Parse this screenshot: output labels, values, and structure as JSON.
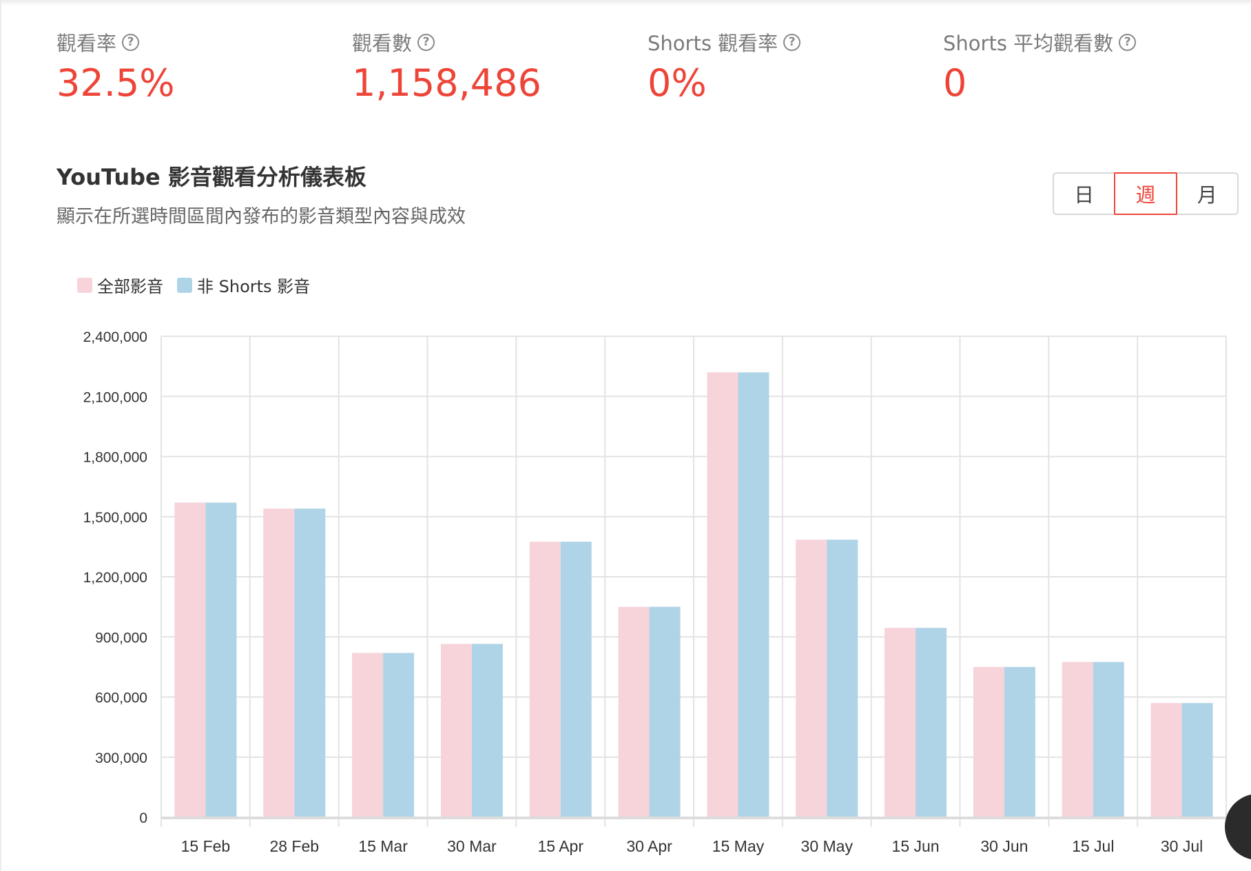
{
  "stats": [
    {
      "label": "觀看率",
      "value": "32.5%"
    },
    {
      "label": "觀看數",
      "value": "1,158,486"
    },
    {
      "label": "Shorts 觀看率",
      "value": "0%"
    },
    {
      "label": "Shorts 平均觀看數",
      "value": "0"
    }
  ],
  "help_glyph": "?",
  "section": {
    "title": "YouTube 影音觀看分析儀表板",
    "subtitle": "顯示在所選時間區間內發布的影音類型內容與成效"
  },
  "period_toggle": {
    "options": [
      "日",
      "週",
      "月"
    ],
    "selected": "週"
  },
  "colors": {
    "accent": "#ee4438",
    "series_all": "#f7d3da",
    "series_non_shorts": "#b0d4e7"
  },
  "chart_data": {
    "type": "bar",
    "categories": [
      "15 Feb",
      "28 Feb",
      "15 Mar",
      "30 Mar",
      "15 Apr",
      "30 Apr",
      "15 May",
      "30 May",
      "15 Jun",
      "30 Jun",
      "15 Jul",
      "30 Jul"
    ],
    "series": [
      {
        "name": "全部影音",
        "color": "#f7d3da",
        "values": [
          1570000,
          1540000,
          820000,
          865000,
          1375000,
          1050000,
          2220000,
          1385000,
          945000,
          750000,
          775000,
          570000
        ]
      },
      {
        "name": "非 Shorts 影音",
        "color": "#b0d4e7",
        "values": [
          1570000,
          1540000,
          820000,
          865000,
          1375000,
          1050000,
          2220000,
          1385000,
          945000,
          750000,
          775000,
          570000
        ]
      }
    ],
    "ylim": [
      0,
      2400000
    ],
    "yticks": [
      "0",
      "300,000",
      "600,000",
      "900,000",
      "1,200,000",
      "1,500,000",
      "1,800,000",
      "2,100,000",
      "2,400,000"
    ],
    "ytick_values": [
      0,
      300000,
      600000,
      900000,
      1200000,
      1500000,
      1800000,
      2100000,
      2400000
    ],
    "grid": true,
    "legend": "top-left"
  }
}
